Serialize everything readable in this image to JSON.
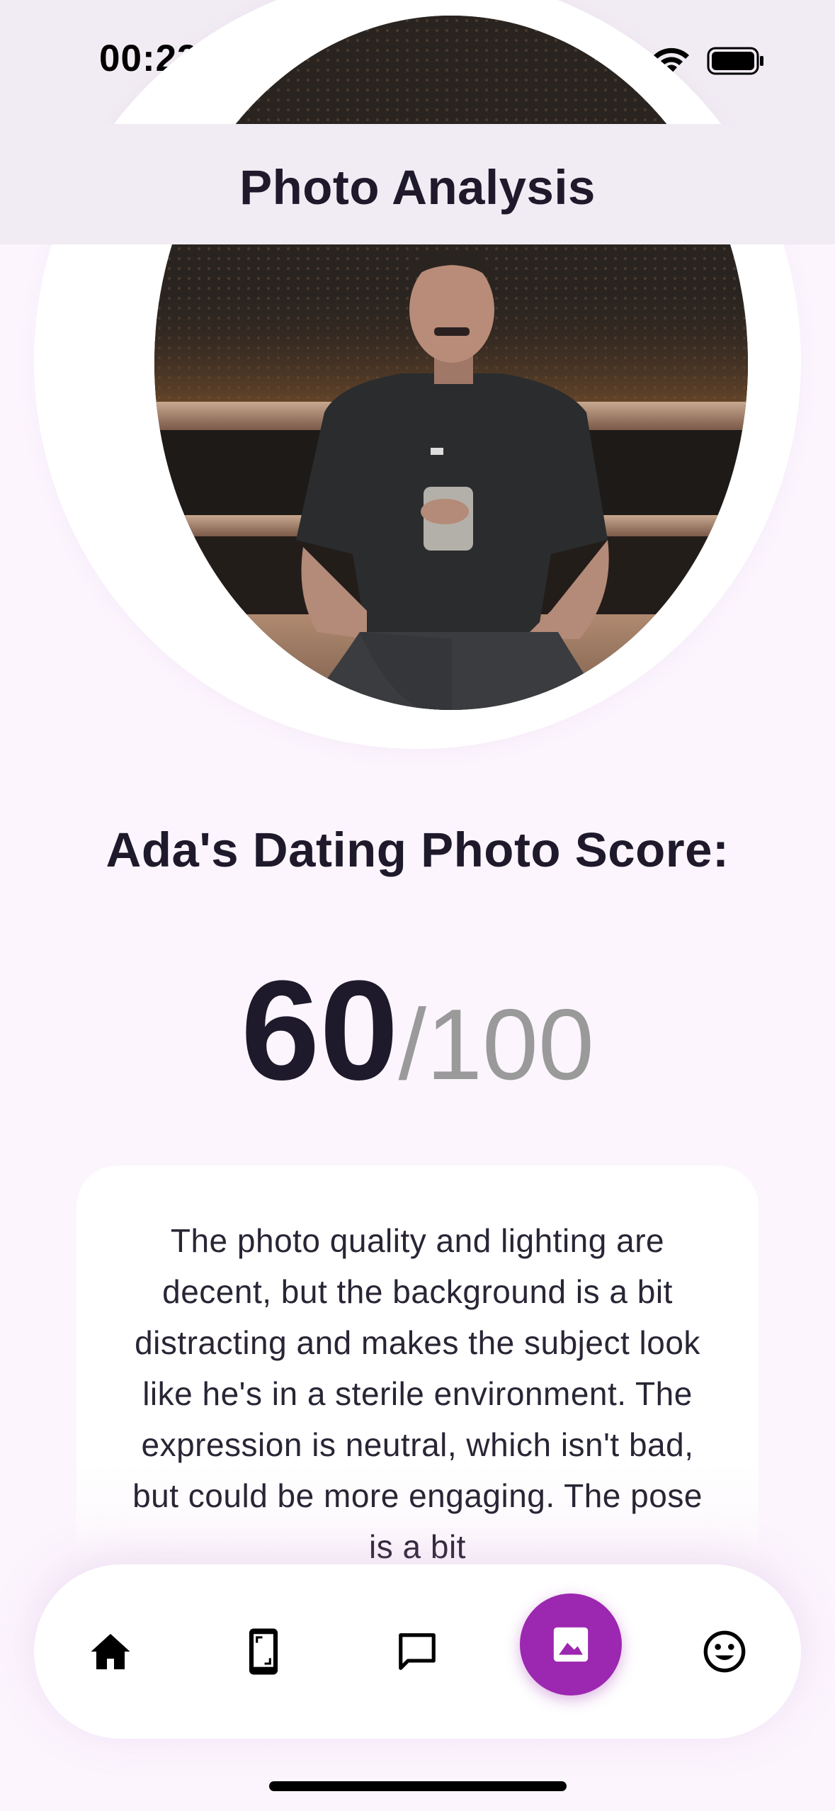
{
  "status_bar": {
    "time": "00:23"
  },
  "app_bar": {
    "title": "Photo Analysis"
  },
  "photo": {
    "subject": "man seated on bench holding a glass"
  },
  "score": {
    "heading": "Ada's Dating Photo Score:",
    "value": "60",
    "total": "/100"
  },
  "feedback": {
    "text": "The photo quality and lighting are decent, but the background is a bit distracting and makes the subject look like he's in a sterile environment. The expression is neutral, which isn't bad, but could be more engaging. The pose is a bit"
  },
  "bottom_nav": {
    "items": [
      {
        "icon": "home-icon"
      },
      {
        "icon": "phone-screen-icon"
      },
      {
        "icon": "chat-bubble-icon"
      },
      {
        "icon": "photo-icon",
        "active": true
      },
      {
        "icon": "smiley-face-icon"
      }
    ],
    "accent_color": "#9c27b0"
  }
}
